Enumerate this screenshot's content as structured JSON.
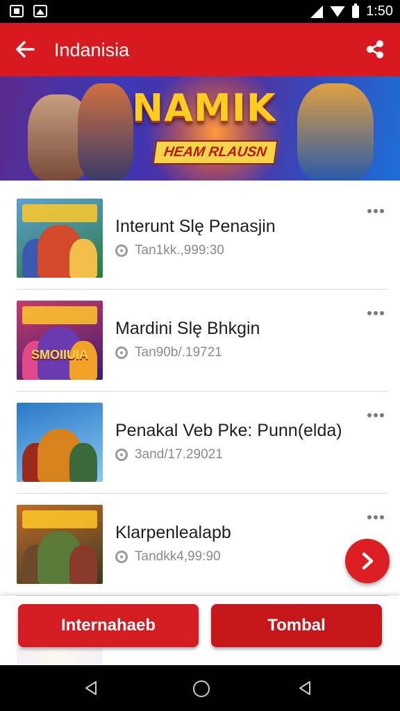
{
  "status_bar": {
    "time": "1:50"
  },
  "app_bar": {
    "title": "Indanisia"
  },
  "banner": {
    "title": "NAMIK",
    "subtitle": "HEAM RLAUSN"
  },
  "list": {
    "items": [
      {
        "title": "Interunt Slę Penasjin",
        "meta": "Tan1kk.,999:30",
        "thumb_colors": [
          "#2e7a3a",
          "#d24a2a",
          "#f2c04a"
        ]
      },
      {
        "title": "Mardini Slę Bhkgin",
        "meta": "Tan90b/.19721",
        "thumb_colors": [
          "#3a1c70",
          "#c83a6a",
          "#f4a12a"
        ],
        "thumb_label": "SMOIIUIA"
      },
      {
        "title": "Penakal Veb Pke: Punn(elda)",
        "meta": "3and/17.29021",
        "thumb_colors": [
          "#2a78c8",
          "#d8821e",
          "#9c2a1c"
        ]
      },
      {
        "title": "Klarpenlealapb",
        "meta": "Tandkk4,99:90",
        "thumb_colors": [
          "#3a3a22",
          "#c06a26",
          "#5a7a3a"
        ]
      }
    ]
  },
  "actions": {
    "primary_label": "Internahaeb",
    "secondary_label": "Tombal"
  },
  "colors": {
    "accent": "#d8191f",
    "button_primary": "#d41d22",
    "button_secondary": "#c4161b"
  },
  "icons": {
    "back": "arrow-left-icon",
    "share": "share-icon",
    "more": "more-dots-icon",
    "clock": "clock-icon",
    "fab": "chevron-right-icon"
  }
}
